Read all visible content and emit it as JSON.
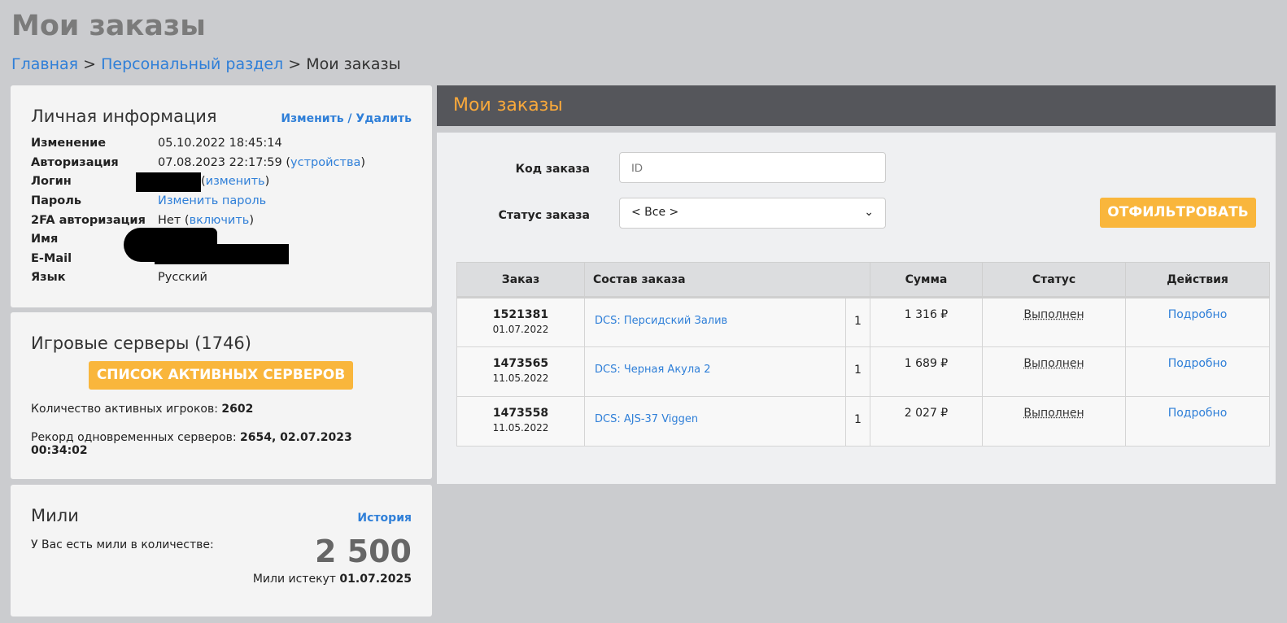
{
  "page": {
    "title": "Мои заказы",
    "breadcrumb": [
      "Главная",
      "Персональный раздел",
      "Мои заказы"
    ],
    "sep": ">"
  },
  "personal": {
    "title": "Личная информация",
    "edit": "Изменить / Удалить",
    "rows": {
      "changed_k": "Изменение",
      "changed_v": "05.10.2022 18:45:14",
      "auth_k": "Авторизация",
      "auth_v": "07.08.2023 22:17:59",
      "devices": "устройства",
      "login_k": "Логин",
      "login_change": "изменить",
      "pass_k": "Пароль",
      "pass_v": "Изменить пароль",
      "twofa_k": "2FA авторизация",
      "twofa_v": "Нет",
      "twofa_enable": "включить",
      "name_k": "Имя",
      "email_k": "E-Mail",
      "lang_k": "Язык",
      "lang_v": "Русский"
    }
  },
  "servers": {
    "title": "Игровые серверы (1746)",
    "button": "СПИСОК АКТИВНЫХ СЕРВЕРОВ",
    "players_label": "Количество активных игроков:",
    "players": "2602",
    "record_label": "Рекорд одновременных серверов:",
    "record": "2654, 02.07.2023 00:34:02"
  },
  "miles": {
    "title": "Мили",
    "history": "История",
    "label": "У Вас есть мили в количестве:",
    "amount": "2 500",
    "expire_label": "Мили истекут",
    "expire": "01.07.2025"
  },
  "orders": {
    "title": "Мои заказы",
    "code_label": "Код заказа",
    "code_placeholder": "ID",
    "status_label": "Статус заказа",
    "status_value": "< Все >",
    "filter": "ОТФИЛЬТРОВАТЬ",
    "headers": [
      "Заказ",
      "Состав заказа",
      "Сумма",
      "Статус",
      "Действия"
    ],
    "rows": [
      {
        "id": "1521381",
        "date": "01.07.2022",
        "item": "DCS: Персидский Залив",
        "qty": "1",
        "sum": "1 316 ₽",
        "status": "Выполнен",
        "action": "Подробно"
      },
      {
        "id": "1473565",
        "date": "11.05.2022",
        "item": "DCS: Черная Акула 2",
        "qty": "1",
        "sum": "1 689 ₽",
        "status": "Выполнен",
        "action": "Подробно"
      },
      {
        "id": "1473558",
        "date": "11.05.2022",
        "item": "DCS: AJS-37 Viggen",
        "qty": "1",
        "sum": "2 027 ₽",
        "status": "Выполнен",
        "action": "Подробно"
      }
    ]
  }
}
